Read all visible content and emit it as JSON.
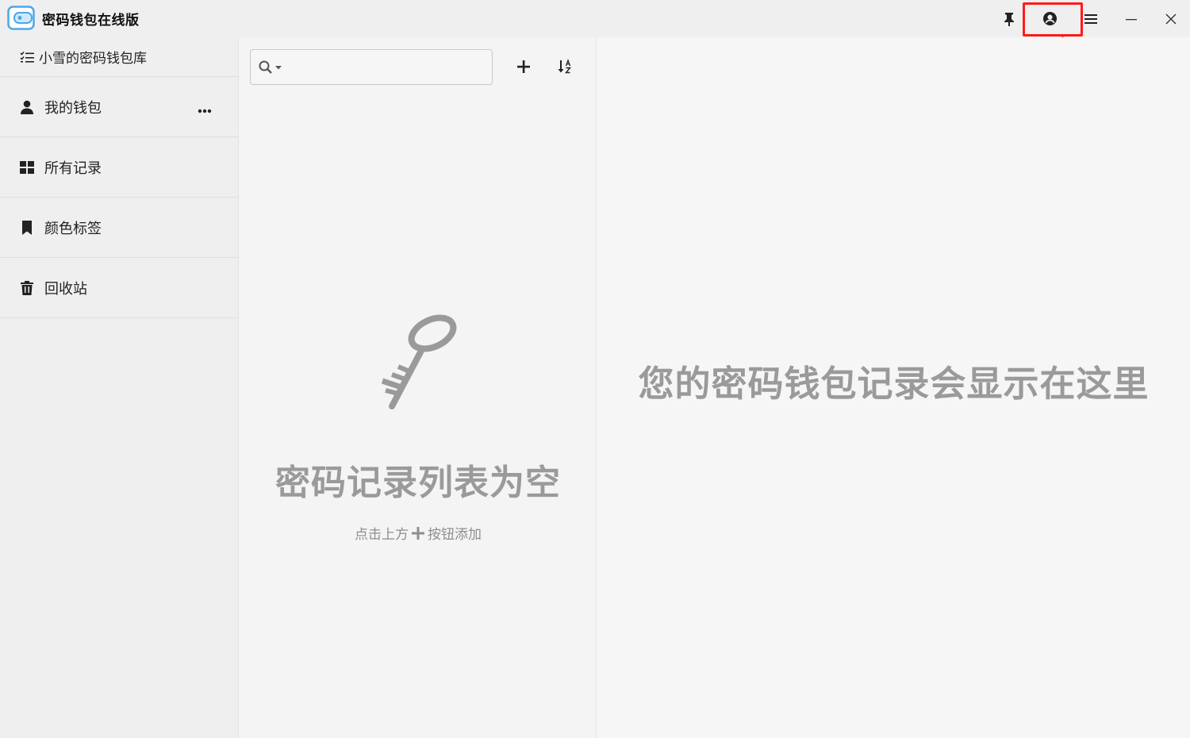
{
  "window": {
    "title": "密码钱包在线版"
  },
  "sidebar": {
    "library_title": "小雪的密码钱包库",
    "items": [
      {
        "label": "我的钱包",
        "icon": "user-icon"
      },
      {
        "label": "所有记录",
        "icon": "grid-icon"
      },
      {
        "label": "颜色标签",
        "icon": "bookmark-icon"
      },
      {
        "label": "回收站",
        "icon": "trash-icon"
      }
    ]
  },
  "list": {
    "search_value": "",
    "empty_title": "密码记录列表为空",
    "empty_hint_before": "点击上方",
    "empty_hint_after": "按钮添加"
  },
  "detail": {
    "placeholder_text": "您的密码钱包记录会显示在这里"
  },
  "colors": {
    "highlight": "#ff1a1a",
    "empty_text": "#9a9a9a",
    "logo_blue": "#4aa8e8"
  }
}
